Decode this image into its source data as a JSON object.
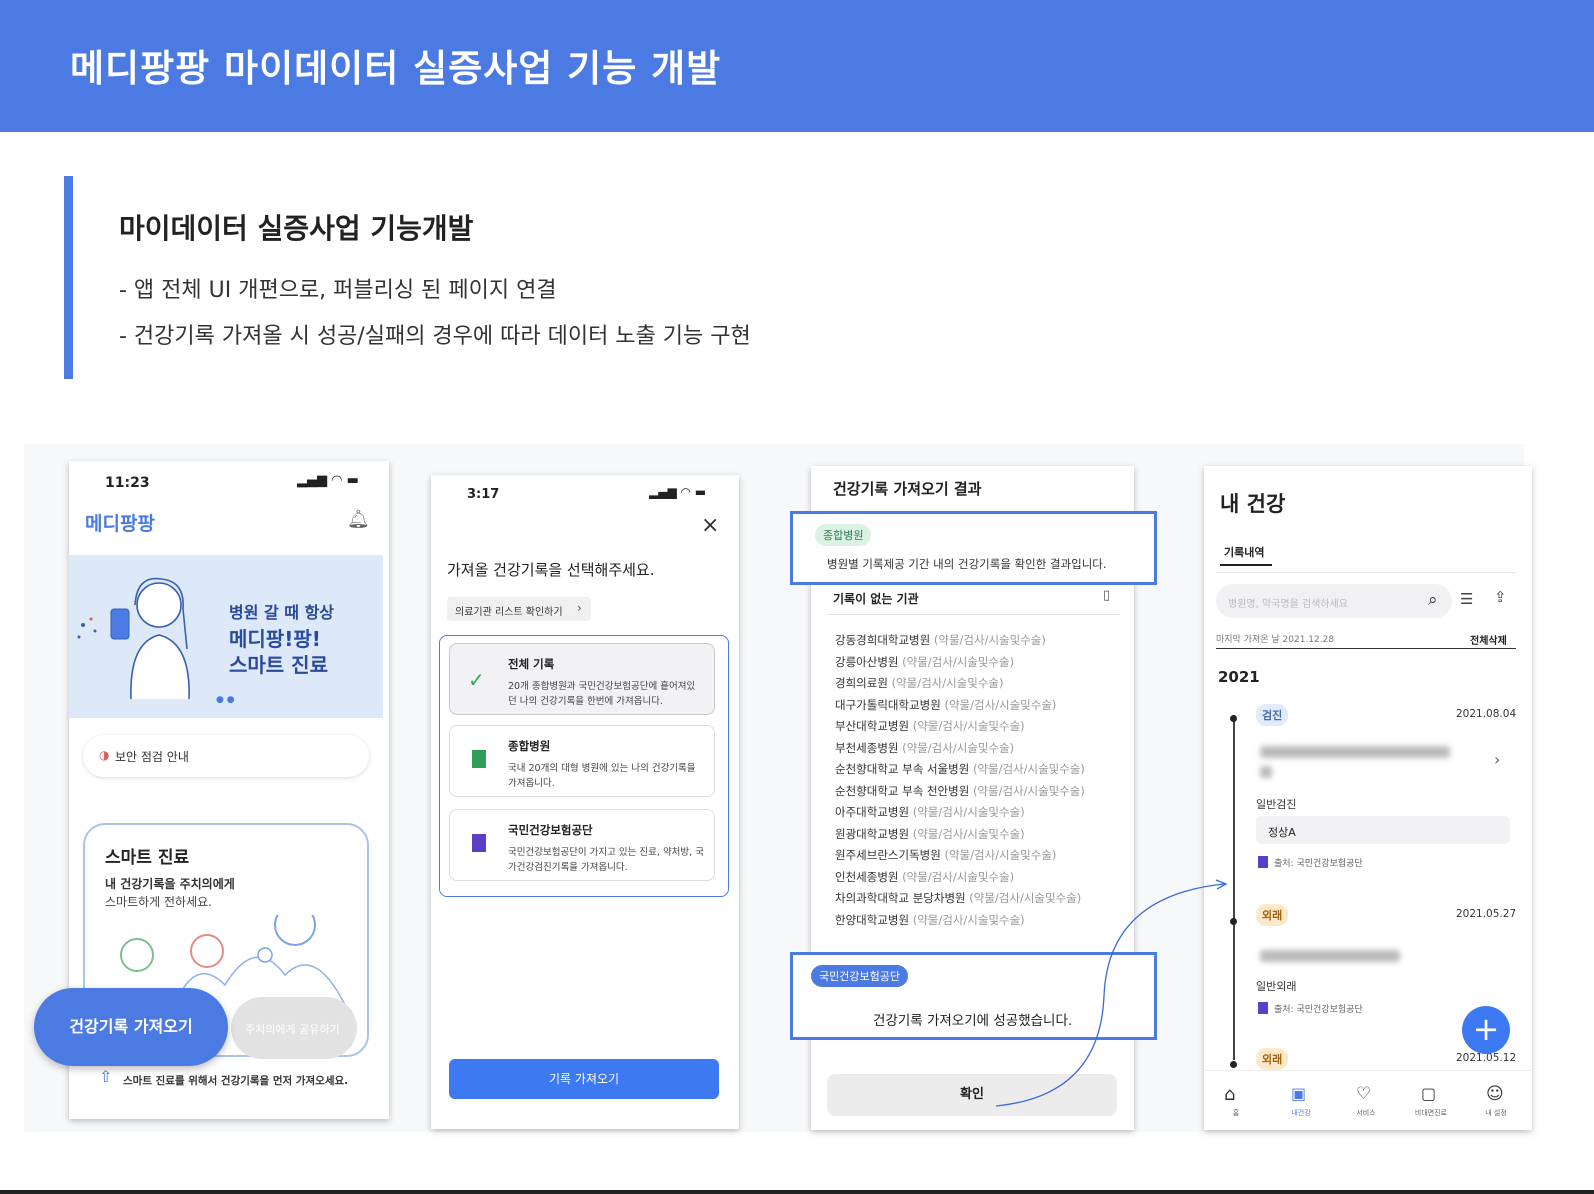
{
  "header": {
    "title": "메디팡팡 마이데이터 실증사업 기능 개발"
  },
  "section": {
    "title": "마이데이터 실증사업 기능개발",
    "bullets": [
      "- 앱 전체 UI 개편으로, 퍼블리싱 된 페이지 연결",
      "- 건강기록 가져올 시 성공/실패의 경우에 따라 데이터 노출 기능 구현"
    ]
  },
  "screen1": {
    "time": "11:23",
    "logo": "메디팡팡",
    "banner_line1": "병원 갈 때 항상",
    "banner_line2": "메디팡!팡!",
    "banner_line3": "스마트 진료",
    "security_notice": "보안 점검 안내",
    "card_title": "스마트 진료",
    "card_line1": "내 건강기록을 주치의에게",
    "card_line2": "스마트하게 전하세요.",
    "fetch_button": "건강기록 가져오기",
    "share_button": "주치의에게 공유하기",
    "footer_note": "스마트 진료를 위해서 건강기록을 먼저 가져오세요."
  },
  "screen2": {
    "time": "3:17",
    "heading": "가져올 건강기록을 선택해주세요.",
    "list_link": "의료기관 리스트 확인하기",
    "options": [
      {
        "title": "전체 기록",
        "desc1": "20개 종합병원과 국민건강보험공단에 흩어져있",
        "desc2": "던 나의 건강기록을 한번에 가져옵니다."
      },
      {
        "title": "종합병원",
        "desc1": "국내 20개의 대형 병원에 있는 나의 건강기록을",
        "desc2": "가져옵니다."
      },
      {
        "title": "국민건강보험공단",
        "desc1": "국민건강보험공단이 가지고 있는 진료, 약처방, 국",
        "desc2": "가건강검진기록을 가져옵니다."
      }
    ],
    "fetch_button": "기록 가져오기"
  },
  "screen3": {
    "title": "건강기록 가져오기 결과",
    "badge_hospital": "종합병원",
    "result_desc": "병원별 기록제공 기간 내의 건강기록을 확인한 결과입니다.",
    "no_record_heading": "기록이 없는 기관",
    "hospitals": [
      {
        "name": "강동경희대학교병원",
        "type": "(약물/검사/시술및수술)"
      },
      {
        "name": "강릉아산병원",
        "type": "(약물/검사/시술및수술)"
      },
      {
        "name": "경희의료원",
        "type": "(약물/검사/시술및수술)"
      },
      {
        "name": "대구가톨릭대학교병원",
        "type": "(약물/검사/시술및수술)"
      },
      {
        "name": "부산대학교병원",
        "type": "(약물/검사/시술및수술)"
      },
      {
        "name": "부천세종병원",
        "type": "(약물/검사/시술및수술)"
      },
      {
        "name": "순천향대학교 부속 서울병원",
        "type": "(약물/검사/시술및수술)"
      },
      {
        "name": "순천향대학교 부속 천안병원",
        "type": "(약물/검사/시술및수술)"
      },
      {
        "name": "아주대학교병원",
        "type": "(약물/검사/시술및수술)"
      },
      {
        "name": "원광대학교병원",
        "type": "(약물/검사/시술및수술)"
      },
      {
        "name": "원주세브란스기독병원",
        "type": "(약물/검사/시술및수술)"
      },
      {
        "name": "인천세종병원",
        "type": "(약물/검사/시술및수술)"
      },
      {
        "name": "차의과학대학교 분당차병원",
        "type": "(약물/검사/시술및수술)"
      },
      {
        "name": "한양대학교병원",
        "type": "(약물/검사/시술및수술)"
      }
    ],
    "badge_nhis": "국민건강보험공단",
    "success_text": "건강기록 가져오기에 성공했습니다.",
    "confirm_button": "확인"
  },
  "screen4": {
    "title": "내 건강",
    "tab": "기록내역",
    "search_placeholder": "병원명, 약국명을 검색하세요",
    "last_fetch": "마지막 가져온 날 2021.12.28",
    "delete_all": "전체삭제",
    "year": "2021",
    "records": [
      {
        "tag": "검진",
        "date": "2021.08.04",
        "type": "일반검진",
        "result": "정상A",
        "source": "출처: 국민건강보험공단"
      },
      {
        "tag": "외래",
        "date": "2021.05.27",
        "type": "일반외래",
        "source": "출처: 국민건강보험공단"
      },
      {
        "tag": "외래",
        "date": "2021.05.12"
      }
    ],
    "nav": [
      "홈",
      "내건강",
      "서비스",
      "비대면진료",
      "내 설정"
    ]
  },
  "colors": {
    "primary": "#4a7ae2",
    "badge_green_bg": "#d9f2e4",
    "tag_orange_bg": "#fde8c8"
  }
}
